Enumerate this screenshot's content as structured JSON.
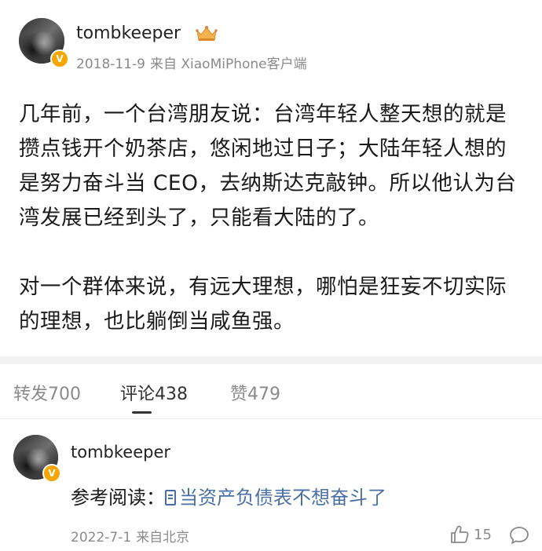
{
  "post": {
    "username": "tombkeeper",
    "date": "2018-11-9",
    "source": "来自 XiaoMiPhone客户端",
    "verified_badge": "V",
    "crown_icon": "crown-icon",
    "paragraphs": [
      "几年前，一个台湾朋友说：台湾年轻人整天想的就是攒点钱开个奶茶店，悠闲地过日子；大陆年轻人想的是努力奋斗当 CEO，去纳斯达克敲钟。所以他认为台湾发展已经到头了，只能看大陆的了。",
      "对一个群体来说，有远大理想，哪怕是狂妄不切实际的理想，也比躺倒当咸鱼强。"
    ]
  },
  "tabs": {
    "repost": "转发700",
    "comments": "评论438",
    "likes": "赞479"
  },
  "comment": {
    "username": "tombkeeper",
    "verified_badge": "V",
    "prefix": "参考阅读：",
    "link_text": "当资产负债表不想奋斗了",
    "date": "2022-7-1",
    "location": "来自北京",
    "like_count": "15"
  },
  "colors": {
    "badge": "#f7a600",
    "link": "#4a6fa5",
    "muted": "#8a8a8a"
  }
}
